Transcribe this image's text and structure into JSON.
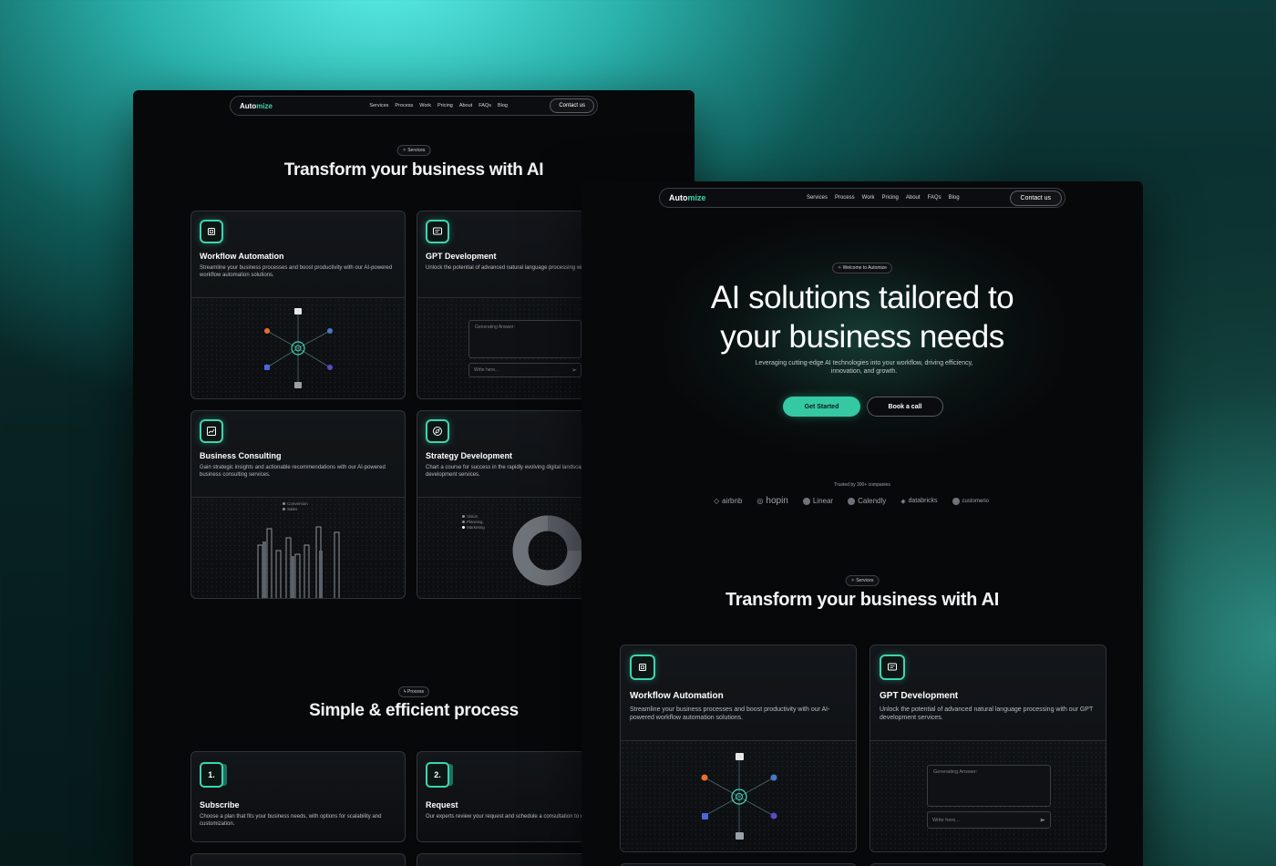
{
  "brand": {
    "name_prefix": "Auto",
    "name_suffix": "mize"
  },
  "nav": {
    "links": [
      "Services",
      "Process",
      "Work",
      "Pricing",
      "About",
      "FAQs",
      "Blog"
    ],
    "contact_label": "Contact us"
  },
  "back_window": {
    "services_pill": "Services",
    "services_title": "Transform your business with AI",
    "cards": [
      {
        "icon": "cpu-icon",
        "title": "Workflow Automation",
        "desc": "Streamline your business processes and boost productivity with our AI-powered workflow automation solutions."
      },
      {
        "icon": "chat-icon",
        "title": "GPT Development",
        "desc": "Unlock the potential of advanced natural language processing with our GPT development services."
      },
      {
        "icon": "chart-icon",
        "title": "Business Consulting",
        "desc": "Gain strategic insights and actionable recommendations with our AI-powered business consulting services."
      },
      {
        "icon": "compass-icon",
        "title": "Strategy Development",
        "desc": "Chart a course for success in the rapidly evolving digital landscape with our AI strategy development services."
      }
    ],
    "gpt_visual": {
      "answer_placeholder": "Generating Answer:",
      "input_placeholder": "Write here..."
    },
    "consulting_legend": [
      "Conversion",
      "Sales"
    ],
    "strategy_legend": [
      "Vision",
      "Planning",
      "Marketing"
    ],
    "process_pill": "Process",
    "process_title": "Simple & efficient process",
    "steps": [
      {
        "num": "1.",
        "title": "Subscribe",
        "desc": "Choose a plan that fits your business needs, with options for scalability and customization."
      },
      {
        "num": "2.",
        "title": "Request",
        "desc": "Our experts review your request and schedule a consultation to discuss your specific needs."
      }
    ]
  },
  "front_window": {
    "hero_pill": "Welcome to Automize",
    "hero_title_line1": "AI solutions tailored to",
    "hero_title_line2": "your business needs",
    "hero_sub": "Leveraging cutting-edge AI technologies into your workflow, driving efficiency, innovation, and growth.",
    "cta_primary": "Get Started",
    "cta_secondary": "Book a call",
    "trusted_label": "Trusted by 300+ companies",
    "logos": [
      "airbnb",
      "hopin",
      "Linear",
      "Calendly",
      "databricks",
      "customerio"
    ],
    "services_pill": "Services",
    "services_title": "Transform your business with AI",
    "cards": [
      {
        "icon": "cpu-icon",
        "title": "Workflow Automation",
        "desc": "Streamline your business processes and boost productivity with our AI-powered workflow automation solutions."
      },
      {
        "icon": "chat-icon",
        "title": "GPT Development",
        "desc": "Unlock the potential of advanced natural language processing with our GPT development services."
      }
    ],
    "gpt_visual": {
      "answer_placeholder": "Generating Answer:",
      "input_placeholder": "Write here..."
    }
  },
  "colors": {
    "accent": "#3dd6b0",
    "primary_button": "#34c9a3",
    "bg": "#07080a"
  }
}
